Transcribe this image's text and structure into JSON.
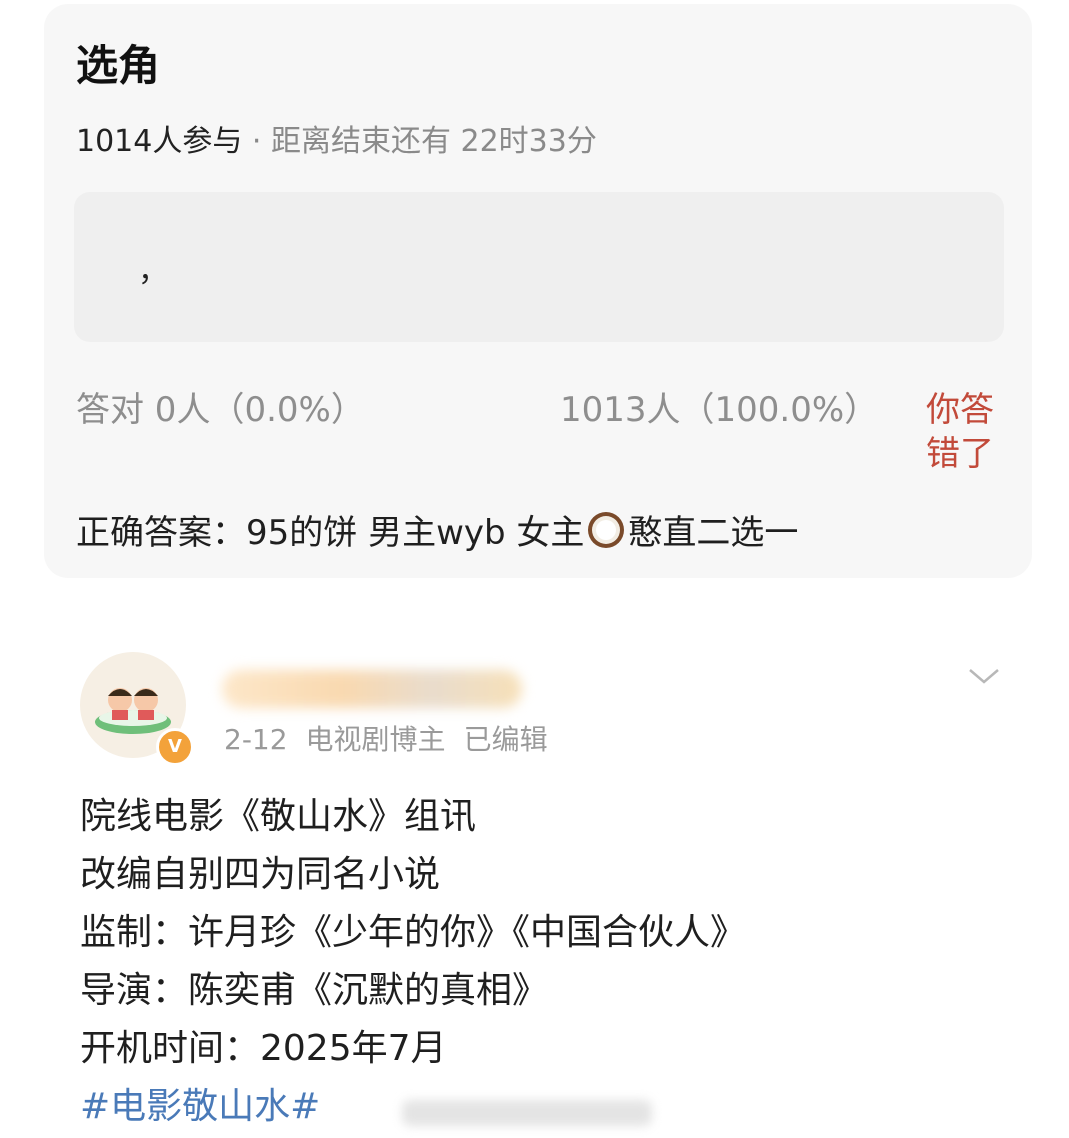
{
  "quiz": {
    "title": "选角",
    "participants": "1014人参与",
    "separator": " · ",
    "remaining": "距离结束还有 22时33分",
    "option_text": "，",
    "stat_correct": "答对  0人（0.0%）",
    "stat_other": "1013人（100.0%）",
    "wrong_badge": "你答错了",
    "answer_prefix": "正确答案：95的饼 男主wyb 女主",
    "answer_suffix": "憨直二选一"
  },
  "post": {
    "date": "2-12",
    "role": "电视剧博主",
    "edited": "已编辑",
    "lines": [
      "院线电影《敬山水》组讯",
      "改编自别四为同名小说",
      "监制：许月珍《少年的你》《中国合伙人》",
      "导演：陈奕甫《沉默的真相》",
      "开机时间：2025年7月"
    ],
    "hashtag": "#电影敬山水#",
    "verified_icon": "V"
  },
  "colors": {
    "wrong": "#c24a3a",
    "hashtag": "#4a7ab8",
    "verified": "#f3a23a"
  }
}
